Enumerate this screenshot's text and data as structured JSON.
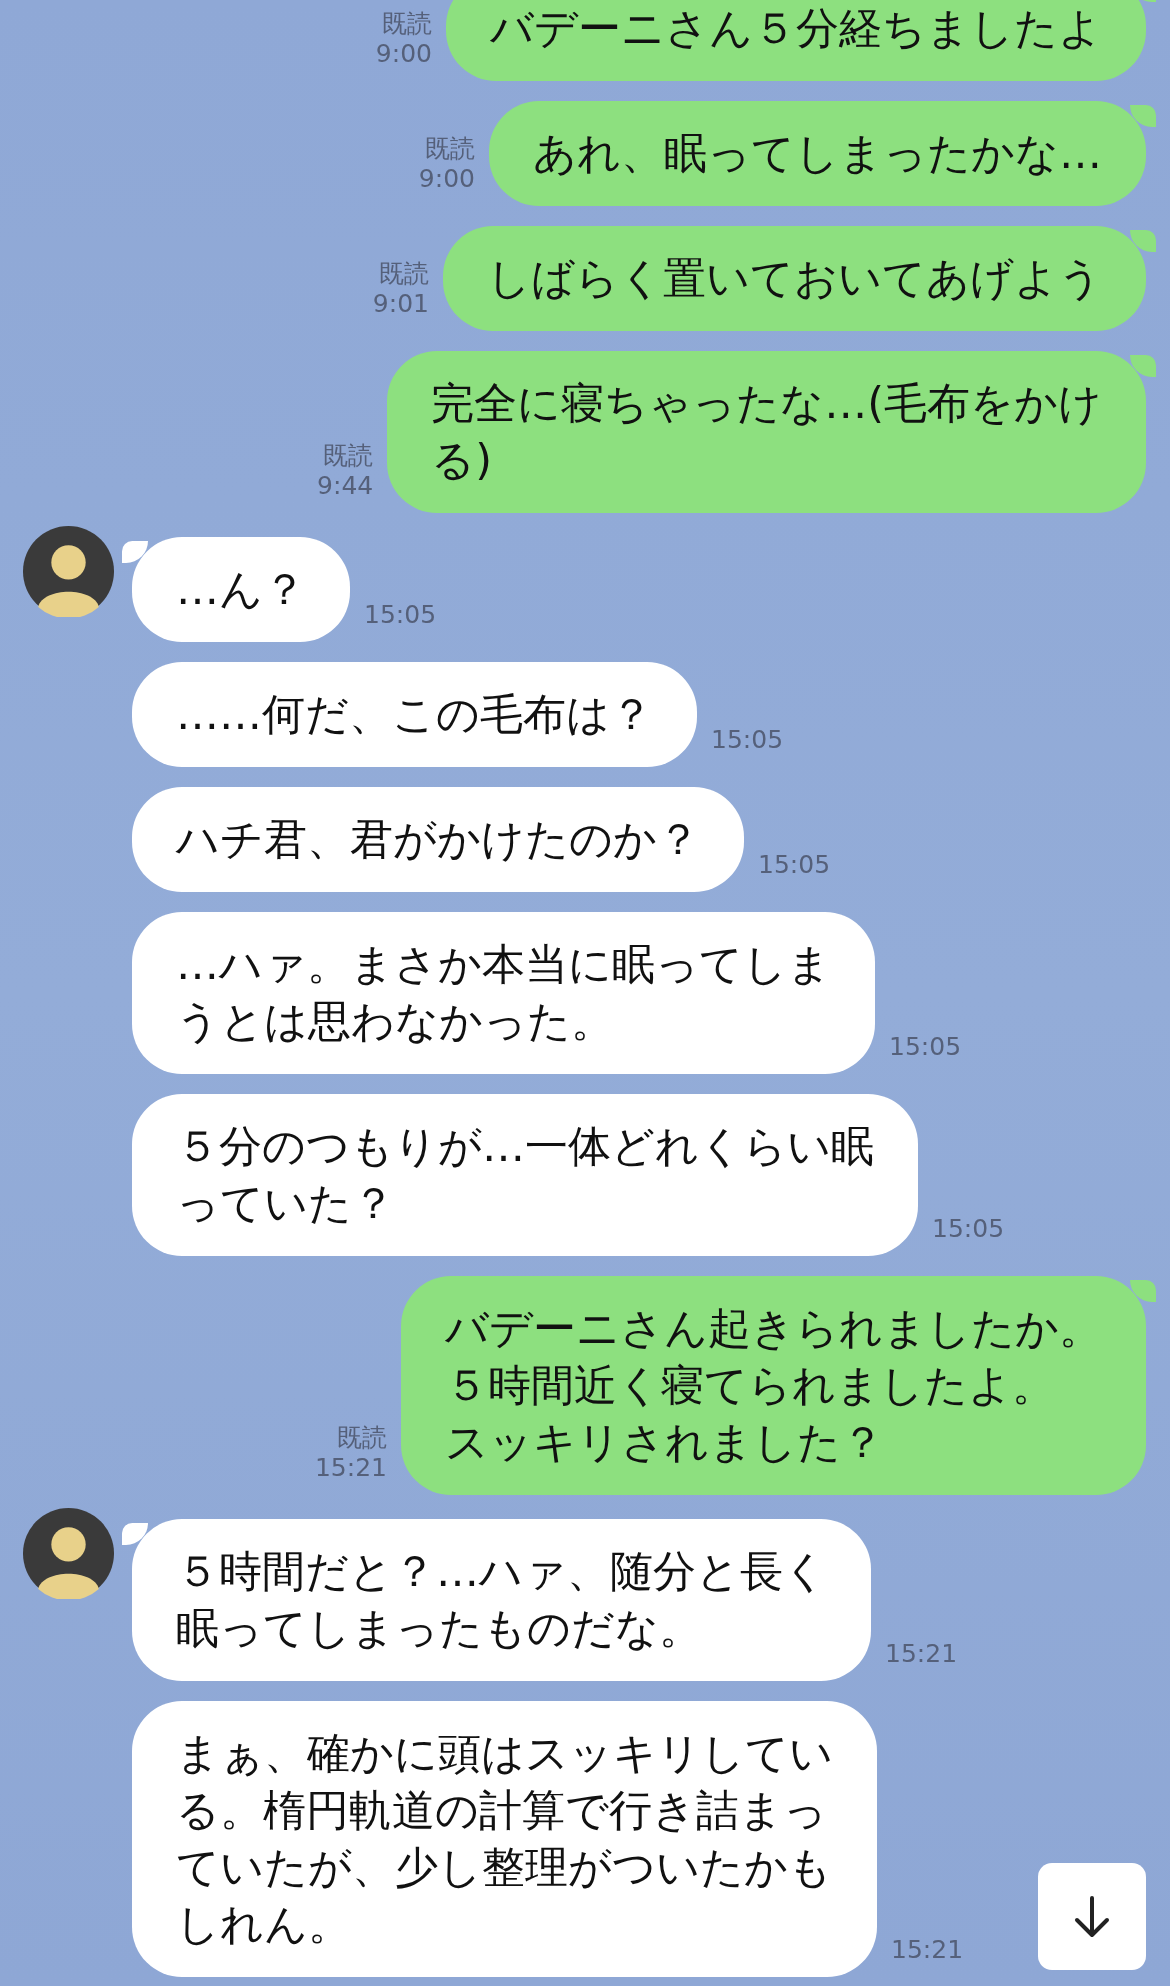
{
  "messages": [
    {
      "kind": "outgoing",
      "lines": [
        "バデーニさん５分経ちましたよ"
      ],
      "read": "既読",
      "time": "9:00"
    },
    {
      "kind": "outgoing",
      "lines": [
        "あれ、眠ってしまったかな…"
      ],
      "read": "既読",
      "time": "9:00"
    },
    {
      "kind": "outgoing",
      "lines": [
        "しばらく置いておいてあげよう"
      ],
      "read": "既読",
      "time": "9:01"
    },
    {
      "kind": "outgoing",
      "lines": [
        "完全に寝ちゃったな…(毛布をかけ",
        "る)"
      ],
      "read": "既読",
      "time": "9:44"
    },
    {
      "kind": "incoming",
      "avatar": true,
      "lines": [
        "…ん？"
      ],
      "time": "15:05"
    },
    {
      "kind": "incoming",
      "avatar": false,
      "lines": [
        "……何だ、この毛布は？"
      ],
      "time": "15:05"
    },
    {
      "kind": "incoming",
      "avatar": false,
      "lines": [
        "ハチ君、君がかけたのか？"
      ],
      "time": "15:05"
    },
    {
      "kind": "incoming",
      "avatar": false,
      "lines": [
        "…ハァ。まさか本当に眠ってしま",
        "うとは思わなかった。"
      ],
      "time": "15:05"
    },
    {
      "kind": "incoming",
      "avatar": false,
      "lines": [
        "５分のつもりが…一体どれくらい眠",
        "っていた？"
      ],
      "time": "15:05"
    },
    {
      "kind": "outgoing",
      "lines": [
        "バデーニさん起きられましたか。",
        "５時間近く寝てられましたよ。",
        "スッキリされました？"
      ],
      "read": "既読",
      "time": "15:21"
    },
    {
      "kind": "incoming",
      "avatar": true,
      "lines": [
        "５時間だと？…ハァ、随分と長く",
        "眠ってしまったものだな。"
      ],
      "time": "15:21"
    },
    {
      "kind": "incoming",
      "avatar": false,
      "lines": [
        "まぁ、確かに頭はスッキリしてい",
        "る。楕円軌道の計算で行き詰まっ",
        "ていたが、少し整理がついたかも",
        "しれん。"
      ],
      "time": "15:21"
    }
  ]
}
